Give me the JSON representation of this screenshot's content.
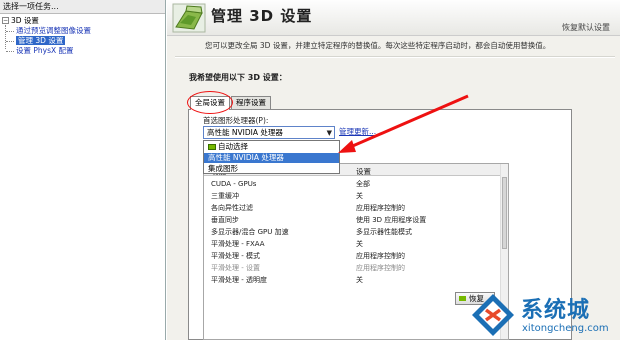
{
  "left_panel": {
    "header": "选择一项任务...",
    "tree": {
      "root": "3D 设置",
      "items": [
        "通过预览调整图像设置",
        "管理 3D 设置",
        "设置 PhysX 配置"
      ]
    }
  },
  "banner": {
    "title": "管理 3D 设置",
    "restore_label": "恢复默认设置"
  },
  "description": "您可以更改全局 3D 设置，并建立特定程序的替换值。每次这些特定程序启动时，都会自动使用替换值。",
  "question": "我希望使用以下 3D 设置：",
  "tabs": [
    {
      "label": "全局设置",
      "active": true
    },
    {
      "label": "程序设置",
      "active": false
    }
  ],
  "processor": {
    "label": "首选图形处理器(P):",
    "selected": "高性能 NVIDIA 处理器",
    "manage_link": "管理更新...",
    "options": [
      "自动选择",
      "高性能 NVIDIA 处理器",
      "集成图形"
    ],
    "highlighted_index": 1
  },
  "settings_table": {
    "col_feature": "功能",
    "col_setting": "设置",
    "rows": [
      {
        "feature": "CUDA - GPUs",
        "value": "全部",
        "dim": false
      },
      {
        "feature": "三重缓冲",
        "value": "关",
        "dim": false
      },
      {
        "feature": "各向异性过滤",
        "value": "应用程序控制的",
        "dim": false
      },
      {
        "feature": "垂直同步",
        "value": "使用 3D 应用程序设置",
        "dim": false
      },
      {
        "feature": "多显示器/混合 GPU 加速",
        "value": "多显示器性能模式",
        "dim": false
      },
      {
        "feature": "平滑处理 - FXAA",
        "value": "关",
        "dim": false
      },
      {
        "feature": "平滑处理 - 模式",
        "value": "应用程序控制的",
        "dim": false
      },
      {
        "feature": "平滑处理 - 设置",
        "value": "应用程序控制的",
        "dim": true
      },
      {
        "feature": "平滑处理 - 透明度",
        "value": "关",
        "dim": false
      }
    ]
  },
  "apply_button": "恢复",
  "watermark": {
    "title": "系统城",
    "subtitle": "xitongcheng.com"
  },
  "colors": {
    "annotation": "#ee1111",
    "link": "#1a36b6",
    "selection": "#3a77cf",
    "nvidia_green": "#76b900",
    "watermark": "#1b6fb5"
  },
  "icons": [
    "nvidia-3d-logo-icon",
    "gpu-icon",
    "dropdown-arrow-icon",
    "watermark-logo-icon"
  ]
}
